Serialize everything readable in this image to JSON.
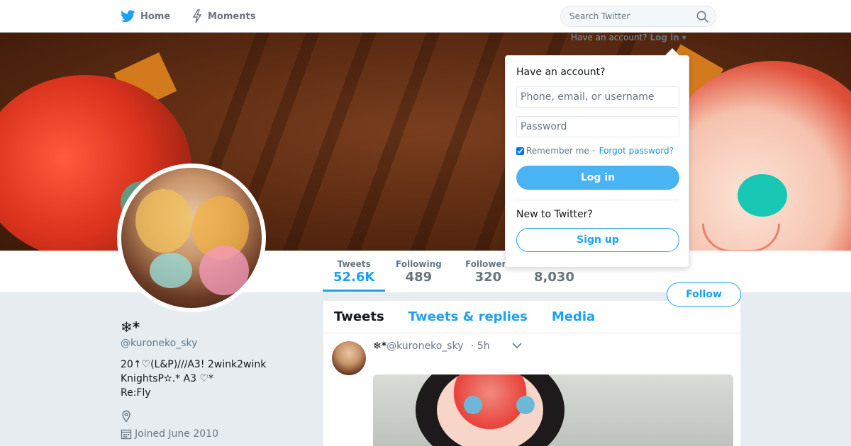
{
  "nav": {
    "home_label": "Home",
    "moments_label": "Moments",
    "search_placeholder": "Search Twitter"
  },
  "login_prompt": {
    "have_account": "Have an account?",
    "login_label": "Log in"
  },
  "stats": [
    {
      "label": "Tweets",
      "value": "52.6K"
    },
    {
      "label": "Following",
      "value": "489"
    },
    {
      "label": "Followers",
      "value": "320"
    },
    {
      "label": "",
      "value": "8,030"
    }
  ],
  "follow_label": "Follow",
  "profile": {
    "name": "❄︎*",
    "handle": "@kuroneko_sky",
    "bio": "20↑♡(L&P)///A3! 2wink2wink\nKnightsP✫.* A3  ♡*\nRe:Fly",
    "joined": "Joined June 2010"
  },
  "timeline": {
    "tabs": [
      "Tweets",
      "Tweets & replies",
      "Media"
    ],
    "tweet": {
      "name": "❄︎*",
      "handle": "@kuroneko_sky",
      "time": "· 5h"
    }
  },
  "login_dropdown": {
    "title": "Have an account?",
    "username_placeholder": "Phone, email, or username",
    "password_placeholder": "Password",
    "remember_label": "Remember me",
    "separator": "·",
    "forgot_label": "Forgot password?",
    "login_button": "Log in",
    "new_title": "New to Twitter?",
    "signup_button": "Sign up"
  },
  "colors": {
    "brand": "#1da1f2",
    "login_button": "#4ab3f4"
  }
}
